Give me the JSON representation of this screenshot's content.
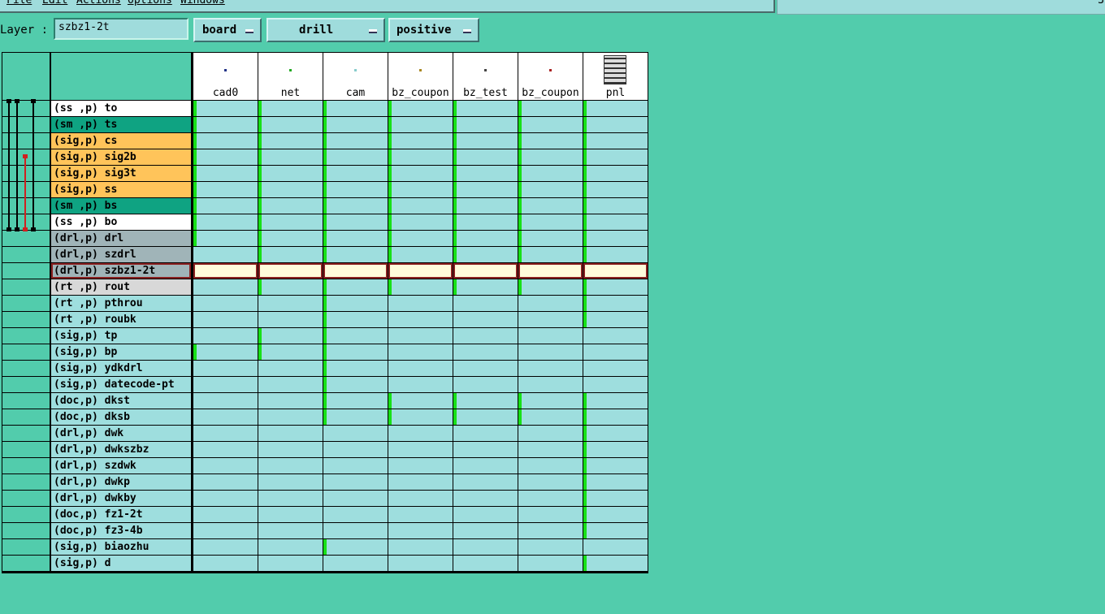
{
  "menu": {
    "items": [
      "File",
      "Edit",
      "Actions",
      "Options",
      "Windows"
    ]
  },
  "right_pane": {
    "partial_text": "3"
  },
  "layer": {
    "label": "Layer :",
    "value": "szbz1-2t"
  },
  "dropdowns": {
    "context": "board",
    "type": "drill",
    "polarity": "positive"
  },
  "columns": [
    {
      "name": "cad0",
      "dot_color": "#223388"
    },
    {
      "name": "net",
      "dot_color": "#22aa22"
    },
    {
      "name": "cam",
      "dot_color": "#88cccc"
    },
    {
      "name": "bz_coupon",
      "dot_color": "#aa8822"
    },
    {
      "name": "bz_test",
      "dot_color": "#444444"
    },
    {
      "name": "bz_coupon",
      "dot_color": "#aa2222"
    },
    {
      "name": "pnl",
      "dot_color": "#333333"
    }
  ],
  "selected_layer": "szbz1-2t",
  "colors": {
    "background": "#52ccac",
    "cell": "#9edede",
    "selected_cell": "#fffbdb",
    "selected_border": "#8a2020",
    "signal": "#ffc45a",
    "soldermask": "#0fa382",
    "drill": "#a0b4b8",
    "rout": "#d8d8d8",
    "active": "#18e018"
  },
  "layers": [
    {
      "name": "(ss ,p) to",
      "kind": "white",
      "marks": [
        1,
        1,
        1,
        1,
        1,
        1,
        1
      ]
    },
    {
      "name": "(sm ,p) ts",
      "kind": "sm",
      "marks": [
        1,
        1,
        1,
        1,
        1,
        1,
        1
      ]
    },
    {
      "name": "(sig,p) cs",
      "kind": "sig",
      "marks": [
        1,
        1,
        1,
        1,
        1,
        1,
        1
      ]
    },
    {
      "name": "(sig,p) sig2b",
      "kind": "sig",
      "marks": [
        1,
        1,
        1,
        1,
        1,
        1,
        1
      ]
    },
    {
      "name": "(sig,p) sig3t",
      "kind": "sig",
      "marks": [
        1,
        1,
        1,
        1,
        1,
        1,
        1
      ]
    },
    {
      "name": "(sig,p) ss",
      "kind": "sig",
      "marks": [
        1,
        1,
        1,
        1,
        1,
        1,
        1
      ]
    },
    {
      "name": "(sm ,p) bs",
      "kind": "sm",
      "marks": [
        1,
        1,
        1,
        1,
        1,
        1,
        1
      ]
    },
    {
      "name": "(ss ,p) bo",
      "kind": "white",
      "marks": [
        1,
        1,
        1,
        1,
        1,
        1,
        1
      ]
    },
    {
      "name": "(drl,p) drl",
      "kind": "drl",
      "marks": [
        1,
        1,
        1,
        1,
        1,
        1,
        1
      ]
    },
    {
      "name": "(drl,p) szdrl",
      "kind": "drl",
      "marks": [
        0,
        1,
        1,
        1,
        1,
        1,
        1
      ]
    },
    {
      "name": "(drl,p) szbz1-2t",
      "kind": "drl",
      "marks": [
        0,
        0,
        0,
        0,
        0,
        0,
        0
      ]
    },
    {
      "name": "(rt ,p) rout",
      "kind": "rt",
      "marks": [
        0,
        1,
        1,
        1,
        1,
        1,
        1
      ]
    },
    {
      "name": "(rt ,p) pthrou",
      "kind": "plain",
      "marks": [
        0,
        0,
        1,
        0,
        0,
        0,
        1
      ]
    },
    {
      "name": "(rt ,p) roubk",
      "kind": "plain",
      "marks": [
        0,
        0,
        1,
        0,
        0,
        0,
        1
      ]
    },
    {
      "name": "(sig,p) tp",
      "kind": "plain",
      "marks": [
        0,
        1,
        1,
        0,
        0,
        0,
        0
      ]
    },
    {
      "name": "(sig,p) bp",
      "kind": "plain",
      "marks": [
        1,
        1,
        1,
        0,
        0,
        0,
        0
      ]
    },
    {
      "name": "(sig,p) ydkdrl",
      "kind": "plain",
      "marks": [
        0,
        0,
        1,
        0,
        0,
        0,
        0
      ]
    },
    {
      "name": "(sig,p) datecode-pt",
      "kind": "plain",
      "marks": [
        0,
        0,
        1,
        0,
        0,
        0,
        0
      ]
    },
    {
      "name": "(doc,p) dkst",
      "kind": "plain",
      "marks": [
        0,
        0,
        1,
        1,
        1,
        1,
        1
      ]
    },
    {
      "name": "(doc,p) dksb",
      "kind": "plain",
      "marks": [
        0,
        0,
        1,
        1,
        1,
        1,
        1
      ]
    },
    {
      "name": "(drl,p) dwk",
      "kind": "plain",
      "marks": [
        0,
        0,
        0,
        0,
        0,
        0,
        1
      ]
    },
    {
      "name": "(drl,p) dwkszbz",
      "kind": "plain",
      "marks": [
        0,
        0,
        0,
        0,
        0,
        0,
        1
      ]
    },
    {
      "name": "(drl,p) szdwk",
      "kind": "plain",
      "marks": [
        0,
        0,
        0,
        0,
        0,
        0,
        1
      ]
    },
    {
      "name": "(drl,p) dwkp",
      "kind": "plain",
      "marks": [
        0,
        0,
        0,
        0,
        0,
        0,
        1
      ]
    },
    {
      "name": "(drl,p) dwkby",
      "kind": "plain",
      "marks": [
        0,
        0,
        0,
        0,
        0,
        0,
        1
      ]
    },
    {
      "name": "(doc,p) fz1-2t",
      "kind": "plain",
      "marks": [
        0,
        0,
        0,
        0,
        0,
        0,
        1
      ]
    },
    {
      "name": "(doc,p) fz3-4b",
      "kind": "plain",
      "marks": [
        0,
        0,
        0,
        0,
        0,
        0,
        1
      ]
    },
    {
      "name": "(sig,p) biaozhu",
      "kind": "plain",
      "marks": [
        0,
        0,
        1,
        0,
        0,
        0,
        0
      ]
    },
    {
      "name": "(sig,p) d",
      "kind": "plain",
      "marks": [
        0,
        0,
        0,
        0,
        0,
        0,
        1
      ]
    }
  ]
}
